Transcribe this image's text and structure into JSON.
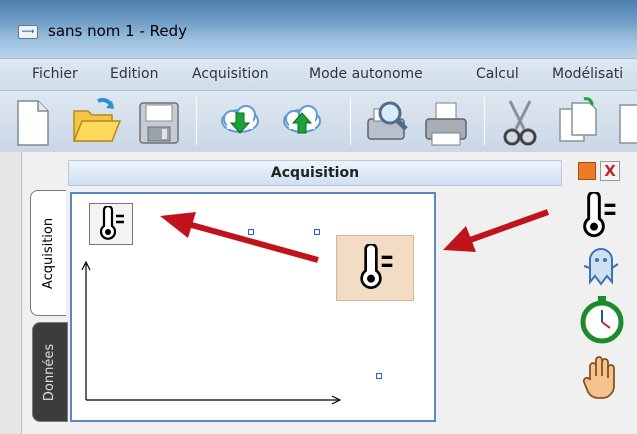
{
  "window": {
    "title": "sans nom 1 - Redy",
    "app_icon": "redy-app-icon"
  },
  "menu": {
    "items": [
      "Fichier",
      "Edition",
      "Acquisition",
      "Mode autonome",
      "Calcul",
      "Modélisati"
    ]
  },
  "toolbar": {
    "buttons": [
      "new-document-icon",
      "open-folder-icon",
      "save-icon",
      "download-cloud-icon",
      "upload-cloud-icon",
      "print-preview-icon",
      "print-icon",
      "cut-icon",
      "copy-icon"
    ]
  },
  "side_tabs": {
    "acquisition": "Acquisition",
    "donnees": "Données"
  },
  "panel": {
    "title": "Acquisition",
    "close_label": "X"
  },
  "palette": {
    "items": [
      "thermometer-icon",
      "ghost-icon",
      "stopwatch-icon",
      "hand-icon"
    ]
  },
  "colors": {
    "arrow": "#c0131b",
    "panel_border": "#5b86c4",
    "floating_widget_bg": "#f2dcc4",
    "close_x": "#c0272d",
    "orange_button": "#f07a2a"
  }
}
